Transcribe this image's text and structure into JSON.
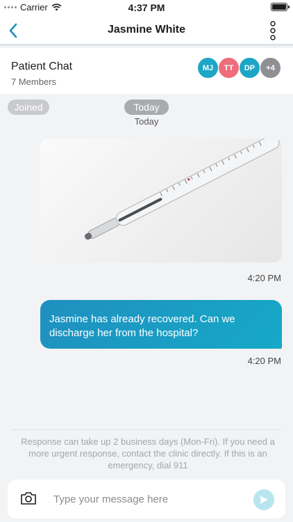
{
  "status_bar": {
    "carrier": "Carrier",
    "time": "4:37 PM"
  },
  "nav": {
    "title": "Jasmine White"
  },
  "chat": {
    "name": "Patient Chat",
    "members": "7 Members",
    "avatars": [
      {
        "initials": "MJ",
        "color": "#1ea6c6"
      },
      {
        "initials": "TT",
        "color": "#ef6c7a"
      },
      {
        "initials": "DP",
        "color": "#1ea6c6"
      },
      {
        "initials": "+4",
        "color": "#8e9094"
      }
    ]
  },
  "pills": {
    "joined": "Joined",
    "today": "Today"
  },
  "date_subtitle": "Today",
  "messages": [
    {
      "type": "image",
      "subject": "thermometer-photo",
      "time": "4:20 PM"
    },
    {
      "type": "text",
      "text": "Jasmine has already recovered. Can we discharge her from the hospital?",
      "time": "4:20 PM"
    }
  ],
  "notice": "Response can take up 2 business days (Mon-Fri). If you need a more urgent response, contact the clinic directly. If this is an emergency, dial 911",
  "composer": {
    "placeholder": "Type your message here",
    "value": ""
  },
  "colors": {
    "accent": "#1ea6c6",
    "bubble": "#1a9cc4",
    "send_disabled": "#b8e6ee"
  },
  "icons": [
    "signal-dots-icon",
    "wifi-icon",
    "battery-icon",
    "back-chevron-icon",
    "more-vertical-icon",
    "camera-icon",
    "send-icon"
  ]
}
